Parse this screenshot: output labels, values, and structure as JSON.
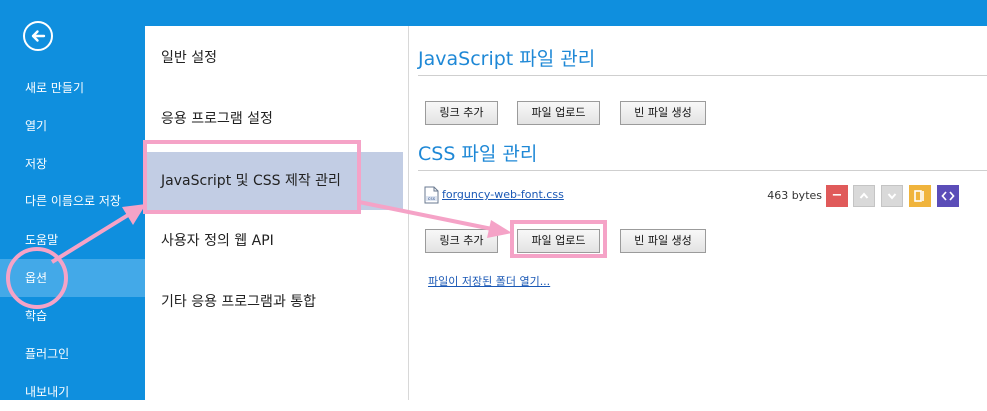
{
  "sidebar": {
    "items": [
      {
        "label": "새로 만들기"
      },
      {
        "label": "열기"
      },
      {
        "label": "저장"
      },
      {
        "label": "다른 이름으로 저장"
      },
      {
        "label": "도움말"
      },
      {
        "label": "옵션"
      },
      {
        "label": "학습"
      },
      {
        "label": "플러그인"
      },
      {
        "label": "내보내기"
      }
    ]
  },
  "categories": {
    "items": [
      {
        "label": "일반 설정"
      },
      {
        "label": "응용 프로그램 설정"
      },
      {
        "label": "JavaScript 및 CSS 제작 관리"
      },
      {
        "label": "사용자 정의 웹 API"
      },
      {
        "label": "기타 응용 프로그램과 통합"
      }
    ]
  },
  "js_section": {
    "title": "JavaScript 파일 관리",
    "buttons": {
      "add_link": "링크 추가",
      "upload": "파일 업로드",
      "new_file": "빈 파일 생성"
    }
  },
  "css_section": {
    "title": "CSS 파일 관리",
    "file": {
      "name": "forguncy-web-font.css",
      "size": "463 bytes"
    },
    "buttons": {
      "add_link": "링크 추가",
      "upload": "파일 업로드",
      "new_file": "빈 파일 생성"
    },
    "folder_link": "파일이 저장된 폴더 열기..."
  },
  "colors": {
    "sidebar": "#0f8fde",
    "accent_title": "#1e88d6",
    "annotation": "#f5a3c7",
    "delete": "#e05a5a",
    "edit": "#f0b43c",
    "code": "#5b4db8"
  }
}
